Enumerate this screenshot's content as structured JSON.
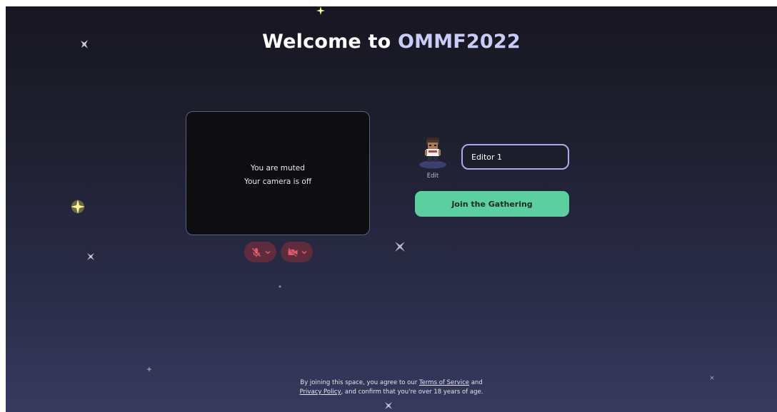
{
  "welcome": {
    "title_prefix": "Welcome to ",
    "space_name": "OMMF2022"
  },
  "video_preview": {
    "mute_status": "You are muted",
    "camera_status": "Your camera is off"
  },
  "controls": {
    "mic_icon": "mic-off-icon",
    "camera_icon": "camera-off-icon",
    "accent_color": "#e05a6e"
  },
  "profile": {
    "edit_label": "Edit",
    "name_value": "Editor 1"
  },
  "join": {
    "label": "Join the Gathering",
    "color": "#5ccfa0"
  },
  "legal": {
    "line1_prefix": "By joining this space, you agree to our ",
    "terms_link": "Terms of Service",
    "line1_suffix": " and",
    "privacy_link": "Privacy Policy",
    "line2_suffix": ", and confirm that you're over 18 years of age."
  }
}
